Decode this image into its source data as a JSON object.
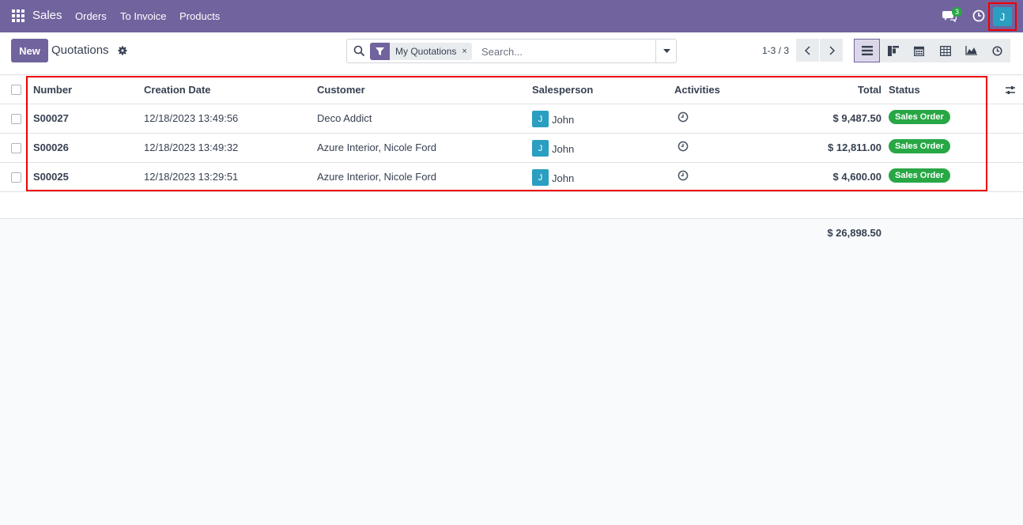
{
  "topnav": {
    "brand": "Sales",
    "menu": [
      "Orders",
      "To Invoice",
      "Products"
    ],
    "messages_badge": "3",
    "user_initial": "J",
    "brand_color": "#71639e"
  },
  "control": {
    "new_label": "New",
    "title": "Quotations",
    "search": {
      "facet_label": "My Quotations",
      "facet_close": "×",
      "placeholder": "Search..."
    },
    "pager": {
      "value": "1-3 / 3",
      "prev": "‹",
      "next": "›"
    },
    "views": [
      "list-view-icon",
      "kanban-view-icon",
      "calendar-view-icon",
      "pivot-view-icon",
      "graph-view-icon",
      "activity-view-icon"
    ],
    "active_view": "list-view-icon"
  },
  "table": {
    "columns": {
      "number": "Number",
      "creation_date": "Creation Date",
      "customer": "Customer",
      "salesperson": "Salesperson",
      "activities": "Activities",
      "total": "Total",
      "status": "Status"
    },
    "rows": [
      {
        "number": "S00027",
        "creation_date": "12/18/2023 13:49:56",
        "customer": "Deco Addict",
        "salesperson_initial": "J",
        "salesperson": "John",
        "total": "$ 9,487.50",
        "status": "Sales Order"
      },
      {
        "number": "S00026",
        "creation_date": "12/18/2023 13:49:32",
        "customer": "Azure Interior, Nicole Ford",
        "salesperson_initial": "J",
        "salesperson": "John",
        "total": "$ 12,811.00",
        "status": "Sales Order"
      },
      {
        "number": "S00025",
        "creation_date": "12/18/2023 13:29:51",
        "customer": "Azure Interior, Nicole Ford",
        "salesperson_initial": "J",
        "salesperson": "John",
        "total": "$ 4,600.00",
        "status": "Sales Order"
      }
    ],
    "grand_total": "$ 26,898.50",
    "status_color": "#28a745"
  }
}
